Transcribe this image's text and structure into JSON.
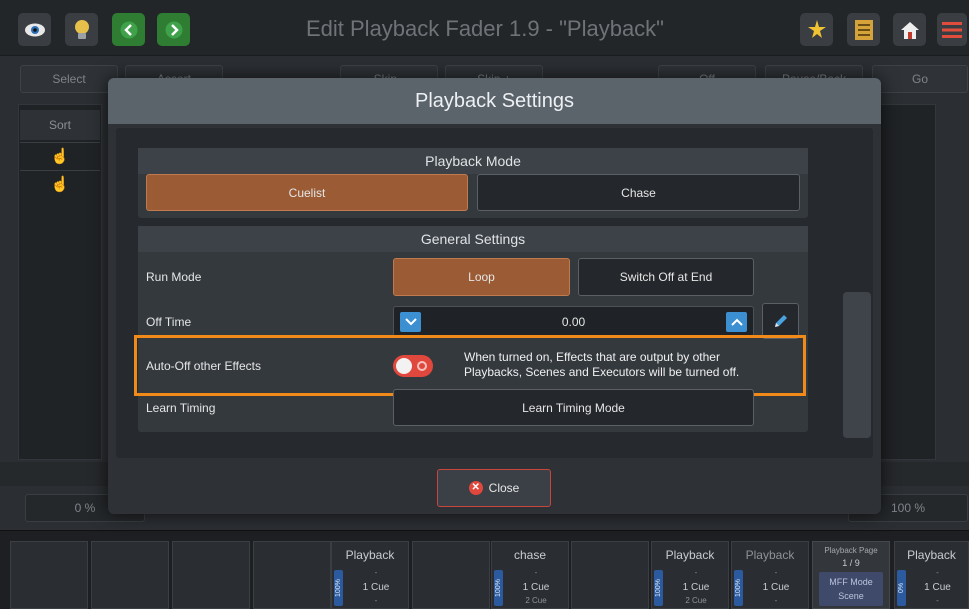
{
  "app": {
    "title": "Edit Playback Fader 1.9 - \"Playback\"",
    "icons_left": [
      "eye-icon",
      "bulb-icon",
      "chevron-left-icon",
      "chevron-right-icon"
    ],
    "icons_right": [
      "magic-icon",
      "sheet-icon",
      "home-icon",
      "menu-icon"
    ]
  },
  "background": {
    "toolbar": [
      "Select",
      "Assert",
      "Skip -",
      "Skip +",
      "Off",
      "Pause/Back",
      "Go"
    ],
    "sort_label": "Sort",
    "pct_left": "0 %",
    "pct_right": "100 %"
  },
  "modal": {
    "title": "Playback Settings",
    "playback_mode": {
      "heading": "Playback Mode",
      "options": [
        "Cuelist",
        "Chase"
      ],
      "selected": "Cuelist"
    },
    "general": {
      "heading": "General Settings",
      "run_mode": {
        "label": "Run Mode",
        "options": [
          "Loop",
          "Switch Off at End"
        ],
        "selected": "Loop"
      },
      "off_time": {
        "label": "Off Time",
        "value": "0.00"
      },
      "auto_off": {
        "label": "Auto-Off other Effects",
        "state": "off",
        "description_line1": "When turned on, Effects that are output by other",
        "description_line2": "Playbacks, Scenes and Executors will be turned off."
      },
      "learn_timing": {
        "label": "Learn Timing",
        "button": "Learn Timing Mode"
      }
    },
    "close_label": "Close"
  },
  "playbacks": [
    {
      "name": "Playback",
      "level": "100%",
      "l1": "-",
      "l2": "1 Cue",
      "l3": "-"
    },
    {
      "name": "chase",
      "level": "100%",
      "l1": "-",
      "l2": "1 Cue",
      "l3": "2 Cue"
    },
    {
      "name": "Playback",
      "level": "100%",
      "l1": "-",
      "l2": "1 Cue",
      "l3": "2 Cue"
    },
    {
      "name": "Playback",
      "level": "100%",
      "l1": "-",
      "l2": "1 Cue",
      "l3": "-"
    },
    {
      "name": "Playback",
      "level": "0%",
      "l1": "-",
      "l2": "1 Cue",
      "l3": "-"
    }
  ],
  "playback_page": {
    "label": "Playback Page",
    "value": "1 / 9",
    "mode": "MFF Mode",
    "mode_value": "Scene"
  },
  "colors": {
    "accent": "#9a5b35",
    "highlight": "#f28a1a",
    "toggle_off": "#e0483d",
    "stepper": "#3c8fd1"
  }
}
